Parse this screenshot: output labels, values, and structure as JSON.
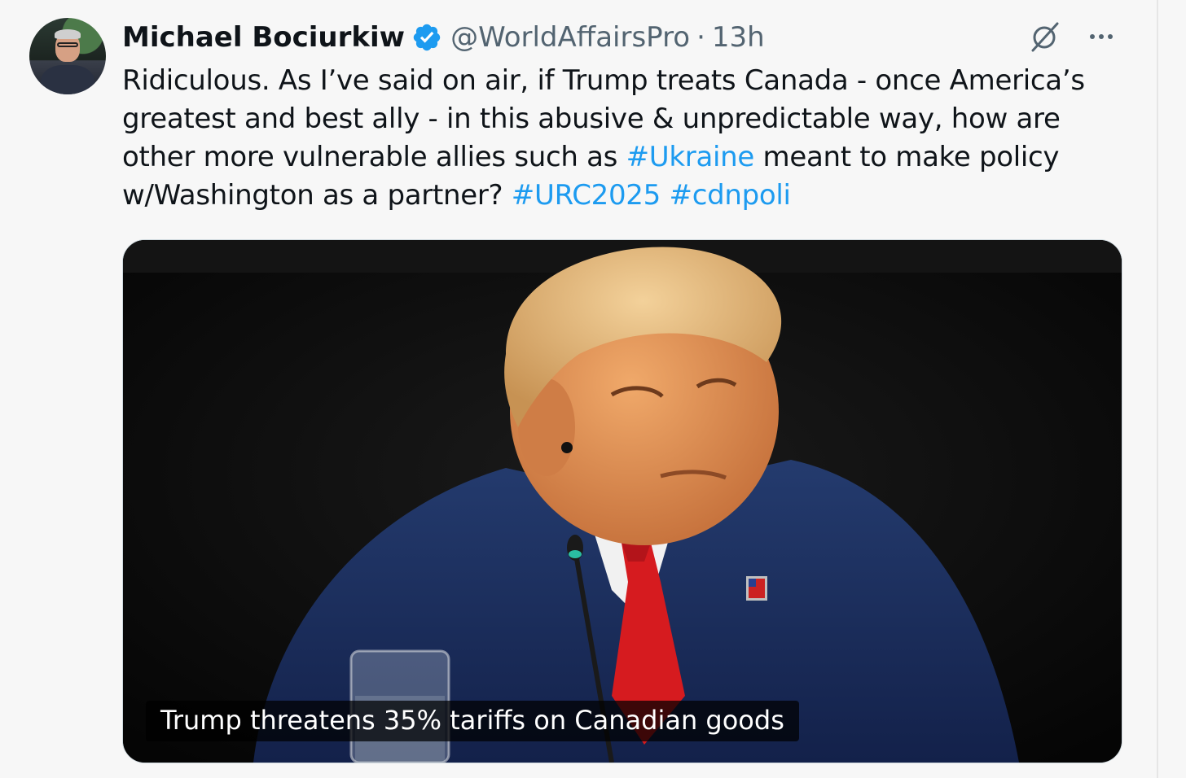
{
  "tweet": {
    "author_name": "Michael Bociurkiw",
    "handle": "@WorldAffairsPro",
    "separator": "·",
    "time": "13h",
    "verified": true,
    "text_before_ukraine": "Ridiculous. As I’ve said on air, if Trump treats Canada - once America’s greatest and best ally - in this abusive & unpredictable way, how are other more vulnerable allies such as ",
    "hashtag_ukraine": "#Ukraine",
    "text_after_ukraine": " meant to make policy w/Washington as a partner? ",
    "hashtag_urc": "#URC2025",
    "hashtag_cdnpoli": "#cdnpoli",
    "media_caption": "Trump threatens 35% tariffs on Canadian goods"
  },
  "icons": {
    "verified": "verified-badge-icon",
    "grok": "grok-icon",
    "more": "more-options-icon"
  },
  "colors": {
    "link": "#1d9bf0",
    "secondary_text": "#536471",
    "background": "#f7f7f7"
  }
}
